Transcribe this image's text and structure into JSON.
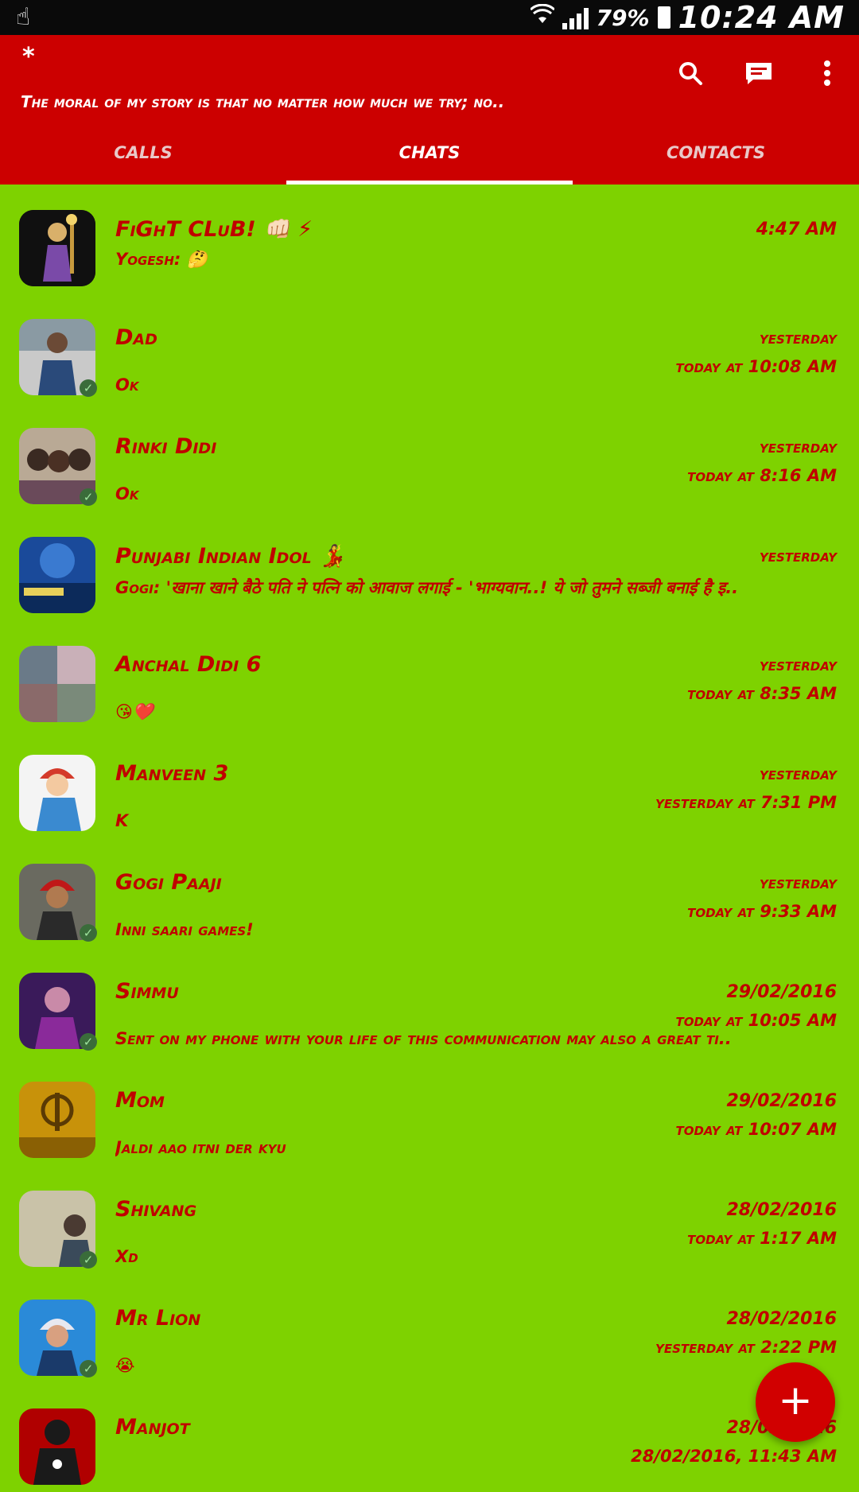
{
  "status_bar": {
    "battery": "79%",
    "time": "10:24 AM"
  },
  "header": {
    "title": "*",
    "status_message": "The moral of my story is that no matter how much we try; no..",
    "tabs": [
      {
        "label": "CALLS"
      },
      {
        "label": "CHATS"
      },
      {
        "label": "CONTACTS"
      }
    ]
  },
  "colors": {
    "accent": "#cc0000",
    "background": "#7ed200",
    "text": "#c00000"
  },
  "chats": [
    {
      "name": "FiGhT CLuB! 👊🏻 ⚡",
      "time": "4:47 AM",
      "seen": "",
      "message": "Yogesh: 🤔"
    },
    {
      "name": "Dad",
      "time": "yesterday",
      "seen": "today at 10:08 AM",
      "message": "Ok"
    },
    {
      "name": "Rinki Didi",
      "time": "yesterday",
      "seen": "today at 8:16 AM",
      "message": "Ok"
    },
    {
      "name": "Punjabi Indian Idol 💃",
      "time": "yesterday",
      "seen": "",
      "message": "Gogi: 'खाना खाने बैठे पति ने पत्नि को आवाज लगाई - 'भाग्यवान..! ये जो तुमने सब्जी बनाई है इ.."
    },
    {
      "name": "Anchal Didi 6",
      "time": "yesterday",
      "seen": "today at 8:35 AM",
      "message": "😘❤️"
    },
    {
      "name": "Manveen 3",
      "time": "yesterday",
      "seen": "yesterday at 7:31 PM",
      "message": "K"
    },
    {
      "name": "Gogi Paaji",
      "time": "yesterday",
      "seen": "today at 9:33 AM",
      "message": "Inni saari games!"
    },
    {
      "name": "Simmu",
      "time": "29/02/2016",
      "seen": "today at 10:05 AM",
      "message": "Sent on my phone with your life of this communication may also a great ti.."
    },
    {
      "name": "Mom",
      "time": "29/02/2016",
      "seen": "today at 10:07 AM",
      "message": "Jaldi aao itni der kyu"
    },
    {
      "name": "Shivang",
      "time": "28/02/2016",
      "seen": "today at 1:17 AM",
      "message": "Xd"
    },
    {
      "name": "Mr Lion",
      "time": "28/02/2016",
      "seen": "yesterday at 2:22 PM",
      "message": "😭"
    },
    {
      "name": "Manjot",
      "time": "28/02/2016",
      "seen": "28/02/2016, 11:43 AM",
      "message": ""
    }
  ],
  "fab": {
    "label": "+"
  }
}
